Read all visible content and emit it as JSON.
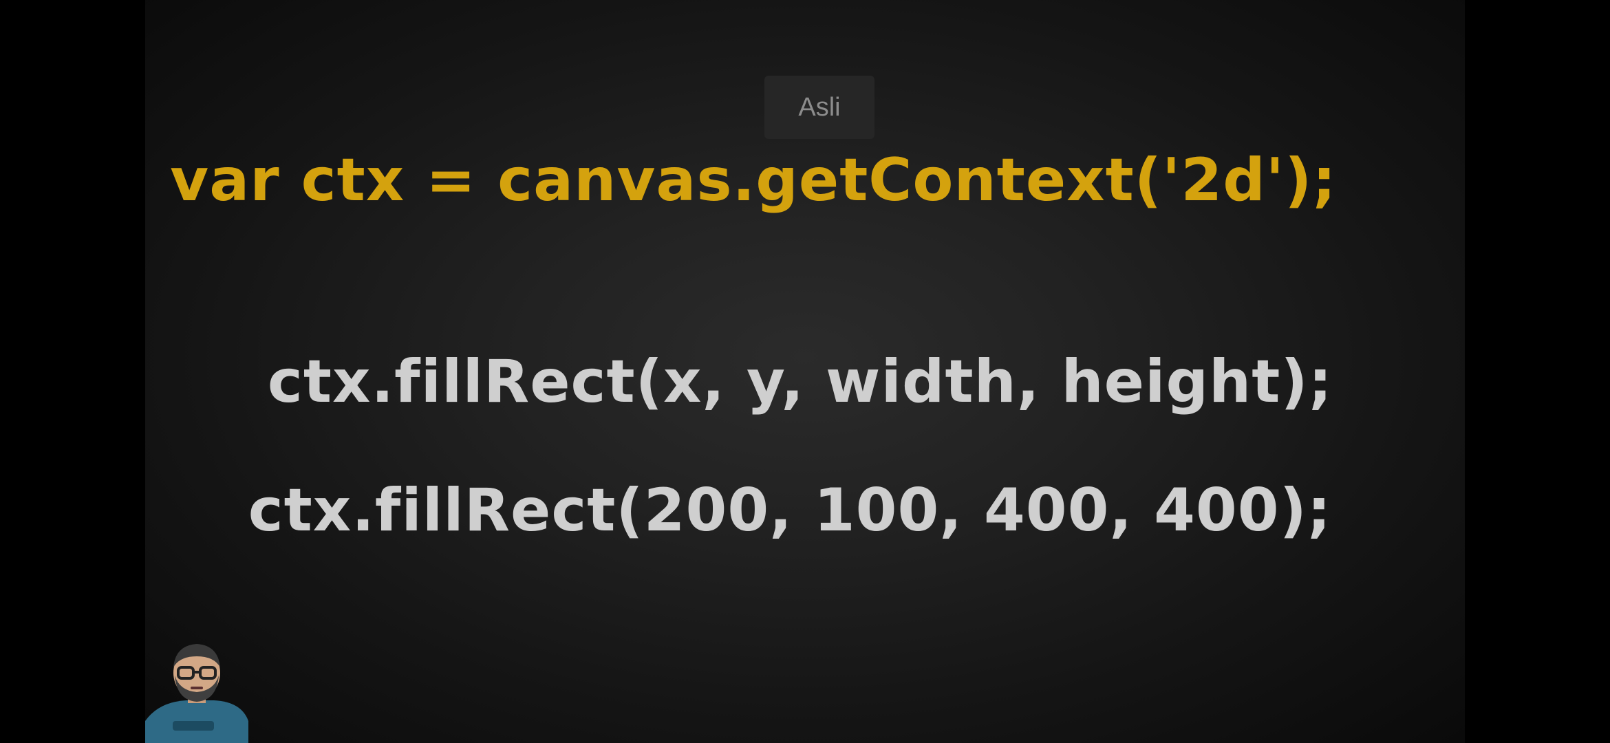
{
  "overlay": {
    "quality_badge": "Asli"
  },
  "slide": {
    "line1": "var ctx = canvas.getContext('2d');",
    "line2": "ctx.fillRect(x, y, width, height);",
    "line3": "ctx.fillRect(200, 100, 400, 400);"
  },
  "colors": {
    "accent": "#d4a20e",
    "code_text": "#cfcfcf",
    "background": "#1e1e1e"
  },
  "presenter": {
    "icon": "presenter-avatar-icon"
  }
}
